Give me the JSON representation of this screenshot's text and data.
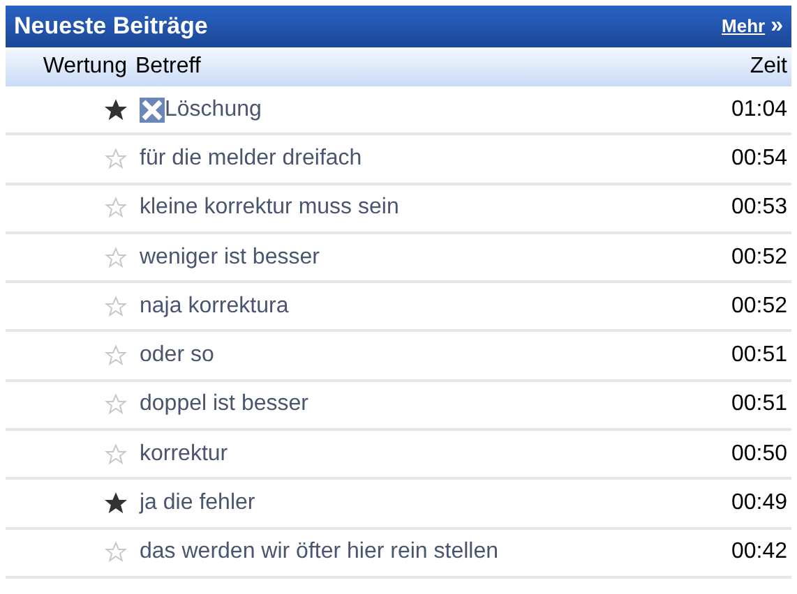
{
  "panel": {
    "title": "Neueste Beiträge",
    "more_link": "Mehr",
    "more_icon": "»"
  },
  "columns": [
    "Wertung",
    "Betreff",
    "Zeit"
  ],
  "rows": [
    {
      "starred": true,
      "kind": "with-icon",
      "subject": "Löschung",
      "time": "01:04"
    },
    {
      "starred": false,
      "kind": "plain",
      "subject": "für die melder dreifach",
      "time": "00:54"
    },
    {
      "starred": false,
      "kind": "plain",
      "subject": "kleine korrektur muss sein",
      "time": "00:53"
    },
    {
      "starred": false,
      "kind": "plain",
      "subject": "weniger ist besser",
      "time": "00:52"
    },
    {
      "starred": false,
      "kind": "plain",
      "subject": "naja korrektura",
      "time": "00:52"
    },
    {
      "starred": false,
      "kind": "plain",
      "subject": "oder so",
      "time": "00:51"
    },
    {
      "starred": false,
      "kind": "plain",
      "subject": "doppel ist besser",
      "time": "00:51"
    },
    {
      "starred": false,
      "kind": "plain",
      "subject": "korrektur",
      "time": "00:50"
    },
    {
      "starred": true,
      "kind": "plain",
      "subject": "ja die fehler",
      "time": "00:49"
    },
    {
      "starred": false,
      "kind": "plain",
      "subject": "das werden wir öfter hier rein stellen",
      "time": "00:42"
    }
  ]
}
